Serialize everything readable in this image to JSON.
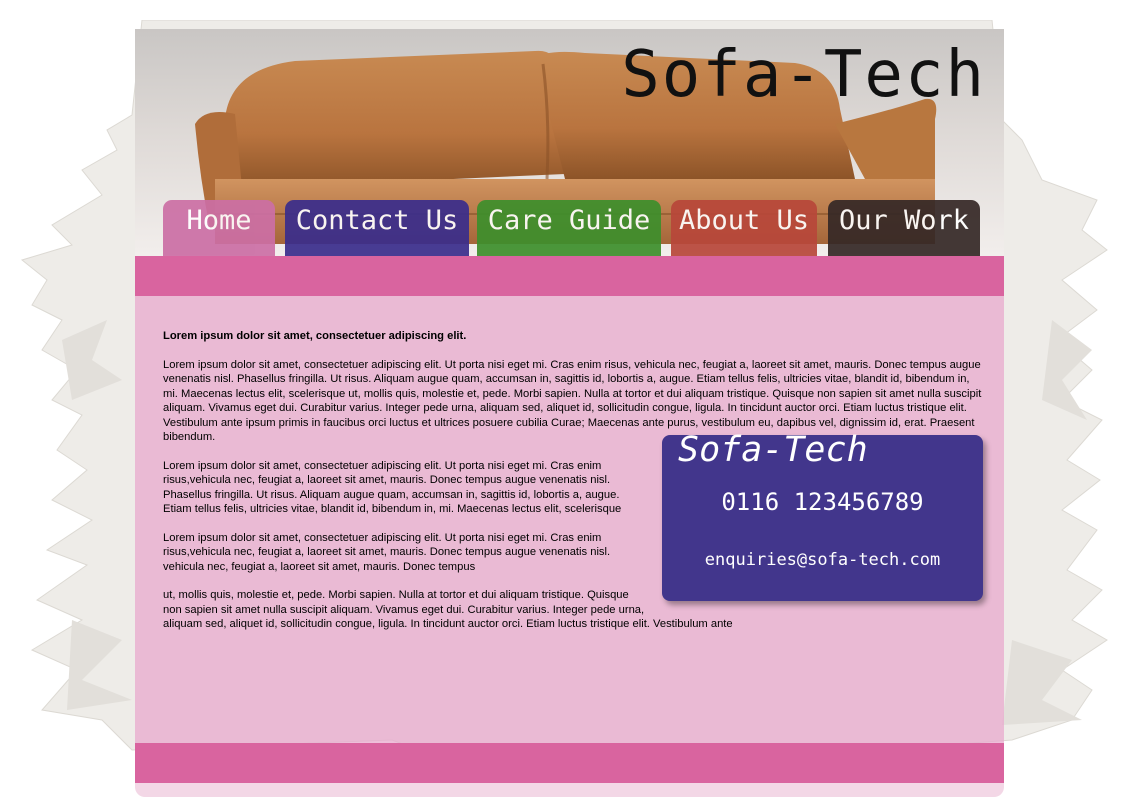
{
  "site": {
    "title": "Sofa-Tech"
  },
  "nav": {
    "items": [
      {
        "label": "Home",
        "color": "#cc6fa5"
      },
      {
        "label": "Contact Us",
        "color": "#3a2d8c"
      },
      {
        "label": "Care Guide",
        "color": "#3d8f2c"
      },
      {
        "label": "About Us",
        "color": "#b8473a"
      },
      {
        "label": "Our Work",
        "color": "#352826"
      }
    ]
  },
  "content": {
    "lead": "Lorem ipsum dolor sit amet, consectetuer adipiscing elit.",
    "paragraphs": [
      "Lorem ipsum dolor sit amet, consectetuer adipiscing elit. Ut porta nisi eget mi. Cras enim risus, vehicula nec, feugiat a, laoreet sit amet, mauris. Donec tempus augue venenatis nisl. Phasellus fringilla. Ut risus. Aliquam augue quam, accumsan in, sagittis id, lobortis a, augue. Etiam tellus felis, ultricies vitae, blandit id, bibendum in, mi. Maecenas lectus elit, scelerisque ut, mollis quis, molestie et, pede. Morbi sapien. Nulla at tortor et dui aliquam tristique. Quisque non sapien sit amet nulla suscipit aliquam. Vivamus eget dui. Curabitur varius. Integer pede urna, aliquam sed, aliquet id, sollicitudin congue, ligula. In tincidunt auctor orci. Etiam luctus tristique elit. Vestibulum ante ipsum primis in faucibus orci luctus et ultrices posuere cubilia Curae; Maecenas ante purus, vestibulum eu, dapibus vel, dignissim id, erat. Praesent bibendum.",
      "Lorem ipsum dolor sit amet, consectetuer adipiscing elit. Ut porta nisi eget mi. Cras enim risus,vehicula nec, feugiat a, laoreet sit amet, mauris. Donec tempus augue venenatis nisl. Phasellus fringilla. Ut risus. Aliquam augue quam, accumsan in, sagittis id, lobortis a, augue. Etiam tellus felis, ultricies vitae, blandit id, bibendum in, mi. Maecenas lectus elit, scelerisque",
      "Lorem ipsum dolor sit amet, consectetuer adipiscing elit. Ut porta nisi eget mi. Cras enim risus,vehicula nec, feugiat a, laoreet sit amet, mauris. Donec tempus augue venenatis nisl. vehicula nec, feugiat a, laoreet sit amet, mauris. Donec tempus",
      "ut, mollis quis, molestie et, pede. Morbi sapien. Nulla at tortor et dui aliquam tristique. Quisque non sapien sit amet nulla suscipit aliquam. Vivamus eget dui. Curabitur varius. Integer pede urna, aliquam sed, aliquet id, sollicitudin congue, ligula. In tincidunt auctor orci. Etiam luctus tristique elit. Vestibulum ante"
    ]
  },
  "contact_card": {
    "title": "Sofa-Tech",
    "phone": "0116 123456789",
    "email": "enquiries@sofa-tech.com"
  },
  "colors": {
    "band": "#d9649f",
    "content_bg": "#e8aace",
    "card_bg": "#42368c"
  }
}
